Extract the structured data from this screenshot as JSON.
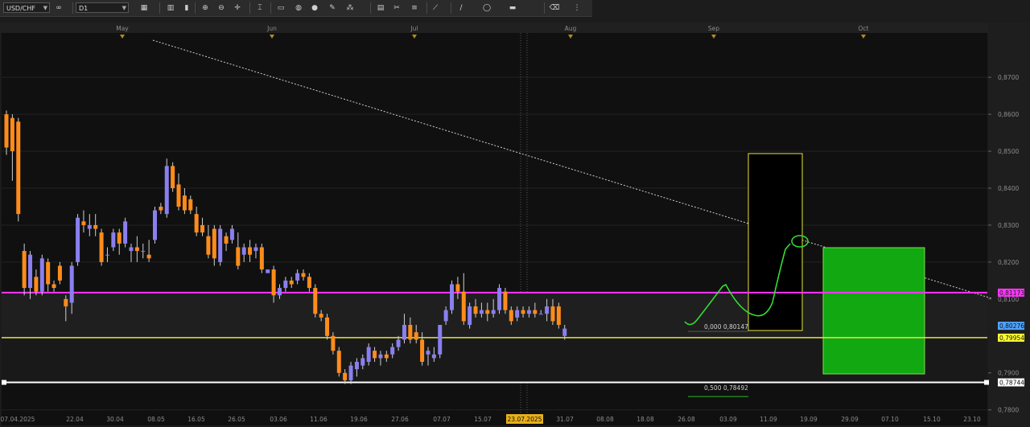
{
  "toolbar": {
    "symbol": "USD/CHF",
    "timeframe": "D1",
    "buttons": [
      {
        "name": "link-icon",
        "glyph": "∞"
      },
      {
        "name": "chart-type-icon",
        "glyph": "▦"
      },
      {
        "name": "bar-chart-icon",
        "glyph": "▥"
      },
      {
        "name": "candles-icon",
        "glyph": "▮"
      },
      {
        "name": "zoom-in-icon",
        "glyph": "⊕"
      },
      {
        "name": "zoom-out-icon",
        "glyph": "⊖"
      },
      {
        "name": "crosshair-icon",
        "glyph": "✛"
      },
      {
        "name": "cursor-icon",
        "glyph": "⌶"
      },
      {
        "name": "note-icon",
        "glyph": "▭"
      },
      {
        "name": "paint-icon",
        "glyph": "◍"
      },
      {
        "name": "globe-icon",
        "glyph": "●"
      },
      {
        "name": "pencil-icon",
        "glyph": "✎"
      },
      {
        "name": "objects-icon",
        "glyph": "⁂"
      },
      {
        "name": "grid-icon",
        "glyph": "▤"
      },
      {
        "name": "tools-icon",
        "glyph": "✂"
      },
      {
        "name": "lines-icon",
        "glyph": "≡"
      },
      {
        "name": "fibo-icon",
        "glyph": "⟋"
      },
      {
        "name": "trend-icon",
        "glyph": "∕"
      },
      {
        "name": "shapes-icon",
        "glyph": "◯"
      },
      {
        "name": "template-icon",
        "glyph": "▬"
      },
      {
        "name": "eraser-icon",
        "glyph": "⌫"
      },
      {
        "name": "more-icon",
        "glyph": "⋮"
      }
    ]
  },
  "chart_data": {
    "type": "candlestick",
    "symbol": "USD/CHF",
    "timeframe": "D1",
    "month_labels": [
      "May",
      "Jun",
      "Jul",
      "Aug",
      "Sep",
      "Oct"
    ],
    "date_labels": [
      "07.04.2025",
      "22.04",
      "30.04",
      "08.05",
      "16.05",
      "26.05",
      "03.06",
      "11.06",
      "19.06",
      "27.06",
      "07.07",
      "15.07",
      "23.07.2025",
      "31.07",
      "08.08",
      "18.08",
      "26.08",
      "03.09",
      "11.09",
      "19.09",
      "29.09",
      "07.10",
      "15.10",
      "23.10"
    ],
    "highlighted_date": "23.07.2025",
    "y_ticks": [
      "0,8700",
      "0,8600",
      "0,8500",
      "0,8400",
      "0,8300",
      "0,8200",
      "0,8100",
      "0,7900",
      "0,7800"
    ],
    "ylim": [
      0.7758,
      0.882
    ],
    "price_tags": [
      {
        "label": "0,81173",
        "value": 0.81173,
        "color": "#ff33ff",
        "text": "#1a1a1a"
      },
      {
        "label": "0,80276",
        "value": 0.80276,
        "color": "#4fa3ff",
        "text": "#101010"
      },
      {
        "label": "0,79954",
        "value": 0.79954,
        "color": "#ffff33",
        "text": "#101010"
      },
      {
        "label": "0,78744",
        "value": 0.78744,
        "color": "#ffffff",
        "text": "#101010"
      }
    ],
    "levels": [
      {
        "label": "0,000 0,80147",
        "value": 0.80147
      },
      {
        "label": "0,500 0,78492",
        "value": 0.78492
      }
    ],
    "colors": {
      "bull": "#8a7ff0",
      "bear": "#ff8c1a",
      "magenta": "#ff33ff",
      "yellow": "#e6e63a",
      "green": "#11a811",
      "background": "#1c1c1c"
    },
    "candles": [
      [
        0.86,
        0.861,
        0.849,
        0.851
      ],
      [
        0.859,
        0.86,
        0.842,
        0.85
      ],
      [
        0.858,
        0.859,
        0.831,
        0.833
      ],
      [
        0.823,
        0.825,
        0.811,
        0.813
      ],
      [
        0.813,
        0.823,
        0.81,
        0.822
      ],
      [
        0.816,
        0.818,
        0.811,
        0.812
      ],
      [
        0.812,
        0.822,
        0.811,
        0.821
      ],
      [
        0.82,
        0.821,
        0.812,
        0.814
      ],
      [
        0.814,
        0.815,
        0.812,
        0.813
      ],
      [
        0.819,
        0.82,
        0.814,
        0.815
      ],
      [
        0.81,
        0.811,
        0.804,
        0.808
      ],
      [
        0.809,
        0.82,
        0.806,
        0.819
      ],
      [
        0.82,
        0.833,
        0.819,
        0.832
      ],
      [
        0.831,
        0.834,
        0.828,
        0.83
      ],
      [
        0.829,
        0.833,
        0.827,
        0.83
      ],
      [
        0.83,
        0.833,
        0.827,
        0.829
      ],
      [
        0.828,
        0.829,
        0.819,
        0.82
      ],
      [
        0.822,
        0.824,
        0.82,
        0.822
      ],
      [
        0.824,
        0.829,
        0.823,
        0.828
      ],
      [
        0.828,
        0.829,
        0.822,
        0.825
      ],
      [
        0.825,
        0.832,
        0.824,
        0.831
      ],
      [
        0.823,
        0.825,
        0.82,
        0.824
      ],
      [
        0.824,
        0.827,
        0.82,
        0.823
      ],
      [
        0.823,
        0.825,
        0.821,
        0.823
      ],
      [
        0.822,
        0.826,
        0.82,
        0.821
      ],
      [
        0.826,
        0.835,
        0.825,
        0.834
      ],
      [
        0.835,
        0.836,
        0.833,
        0.834
      ],
      [
        0.833,
        0.848,
        0.832,
        0.846
      ],
      [
        0.846,
        0.847,
        0.839,
        0.84
      ],
      [
        0.841,
        0.844,
        0.834,
        0.835
      ],
      [
        0.838,
        0.84,
        0.833,
        0.834
      ],
      [
        0.837,
        0.838,
        0.833,
        0.834
      ],
      [
        0.833,
        0.835,
        0.827,
        0.828
      ],
      [
        0.83,
        0.832,
        0.827,
        0.828
      ],
      [
        0.827,
        0.83,
        0.821,
        0.822
      ],
      [
        0.829,
        0.83,
        0.819,
        0.821
      ],
      [
        0.82,
        0.83,
        0.819,
        0.829
      ],
      [
        0.827,
        0.828,
        0.823,
        0.825
      ],
      [
        0.826,
        0.83,
        0.825,
        0.829
      ],
      [
        0.824,
        0.828,
        0.818,
        0.819
      ],
      [
        0.822,
        0.825,
        0.82,
        0.824
      ],
      [
        0.824,
        0.826,
        0.82,
        0.822
      ],
      [
        0.823,
        0.825,
        0.821,
        0.824
      ],
      [
        0.824,
        0.825,
        0.817,
        0.818
      ],
      [
        0.817,
        0.818,
        0.818,
        0.818
      ],
      [
        0.818,
        0.819,
        0.809,
        0.811
      ],
      [
        0.811,
        0.814,
        0.81,
        0.813
      ],
      [
        0.813,
        0.816,
        0.812,
        0.815
      ],
      [
        0.815,
        0.816,
        0.813,
        0.814
      ],
      [
        0.815,
        0.818,
        0.814,
        0.817
      ],
      [
        0.817,
        0.818,
        0.815,
        0.816
      ],
      [
        0.816,
        0.817,
        0.812,
        0.813
      ],
      [
        0.813,
        0.814,
        0.805,
        0.806
      ],
      [
        0.806,
        0.807,
        0.804,
        0.805
      ],
      [
        0.805,
        0.806,
        0.799,
        0.8
      ],
      [
        0.8,
        0.801,
        0.795,
        0.796
      ],
      [
        0.796,
        0.797,
        0.789,
        0.79
      ],
      [
        0.79,
        0.791,
        0.787,
        0.788
      ],
      [
        0.788,
        0.793,
        0.787,
        0.792
      ],
      [
        0.791,
        0.794,
        0.789,
        0.793
      ],
      [
        0.792,
        0.795,
        0.791,
        0.794
      ],
      [
        0.793,
        0.798,
        0.792,
        0.797
      ],
      [
        0.796,
        0.797,
        0.793,
        0.794
      ],
      [
        0.794,
        0.796,
        0.792,
        0.795
      ],
      [
        0.795,
        0.796,
        0.793,
        0.794
      ],
      [
        0.795,
        0.798,
        0.794,
        0.797
      ],
      [
        0.797,
        0.8,
        0.796,
        0.799
      ],
      [
        0.799,
        0.806,
        0.798,
        0.803
      ],
      [
        0.803,
        0.805,
        0.798,
        0.799
      ],
      [
        0.801,
        0.803,
        0.798,
        0.799
      ],
      [
        0.799,
        0.801,
        0.792,
        0.793
      ],
      [
        0.795,
        0.797,
        0.792,
        0.796
      ],
      [
        0.794,
        0.797,
        0.793,
        0.795
      ],
      [
        0.795,
        0.803,
        0.794,
        0.803
      ],
      [
        0.804,
        0.808,
        0.803,
        0.807
      ],
      [
        0.807,
        0.815,
        0.806,
        0.814
      ],
      [
        0.814,
        0.816,
        0.81,
        0.812
      ],
      [
        0.812,
        0.817,
        0.803,
        0.804
      ],
      [
        0.803,
        0.809,
        0.802,
        0.808
      ],
      [
        0.808,
        0.81,
        0.805,
        0.806
      ],
      [
        0.806,
        0.809,
        0.805,
        0.807
      ],
      [
        0.807,
        0.809,
        0.804,
        0.806
      ],
      [
        0.806,
        0.81,
        0.805,
        0.807
      ],
      [
        0.807,
        0.814,
        0.806,
        0.813
      ],
      [
        0.812,
        0.813,
        0.806,
        0.807
      ],
      [
        0.807,
        0.808,
        0.803,
        0.804
      ],
      [
        0.805,
        0.808,
        0.804,
        0.807
      ],
      [
        0.807,
        0.808,
        0.805,
        0.806
      ],
      [
        0.806,
        0.808,
        0.805,
        0.807
      ],
      [
        0.807,
        0.809,
        0.805,
        0.806
      ],
      [
        0.806,
        0.807,
        0.806,
        0.806
      ],
      [
        0.806,
        0.81,
        0.804,
        0.808
      ],
      [
        0.808,
        0.81,
        0.803,
        0.804
      ],
      [
        0.808,
        0.809,
        0.802,
        0.803
      ],
      [
        0.8,
        0.803,
        0.799,
        0.802
      ]
    ]
  }
}
